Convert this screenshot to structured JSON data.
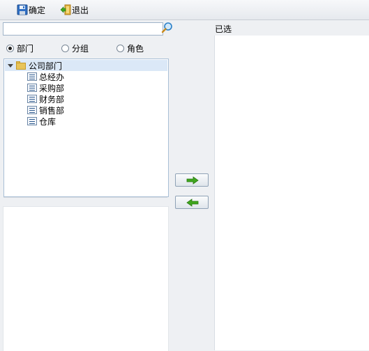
{
  "toolbar": {
    "confirm_label": "确定",
    "exit_label": "退出"
  },
  "search": {
    "value": "",
    "placeholder": ""
  },
  "selected_panel": {
    "title": "已选",
    "items": []
  },
  "radio_group": {
    "options": [
      {
        "label": "部门",
        "checked": true
      },
      {
        "label": "分组",
        "checked": false
      },
      {
        "label": "角色",
        "checked": false
      }
    ]
  },
  "tree": {
    "root": {
      "label": "公司部门",
      "expanded": true
    },
    "children": [
      "总经办",
      "采购部",
      "财务部",
      "销售部",
      "仓库"
    ]
  },
  "icons": {
    "confirm": "save-disk-icon",
    "exit": "exit-door-icon",
    "search": "magnifier-icon",
    "add": "arrow-right-icon",
    "remove": "arrow-left-icon"
  },
  "colors": {
    "tree_selection": "#dbe8f7",
    "arrow_green": "#3fa61e",
    "panel_border": "#a9bfd6"
  }
}
